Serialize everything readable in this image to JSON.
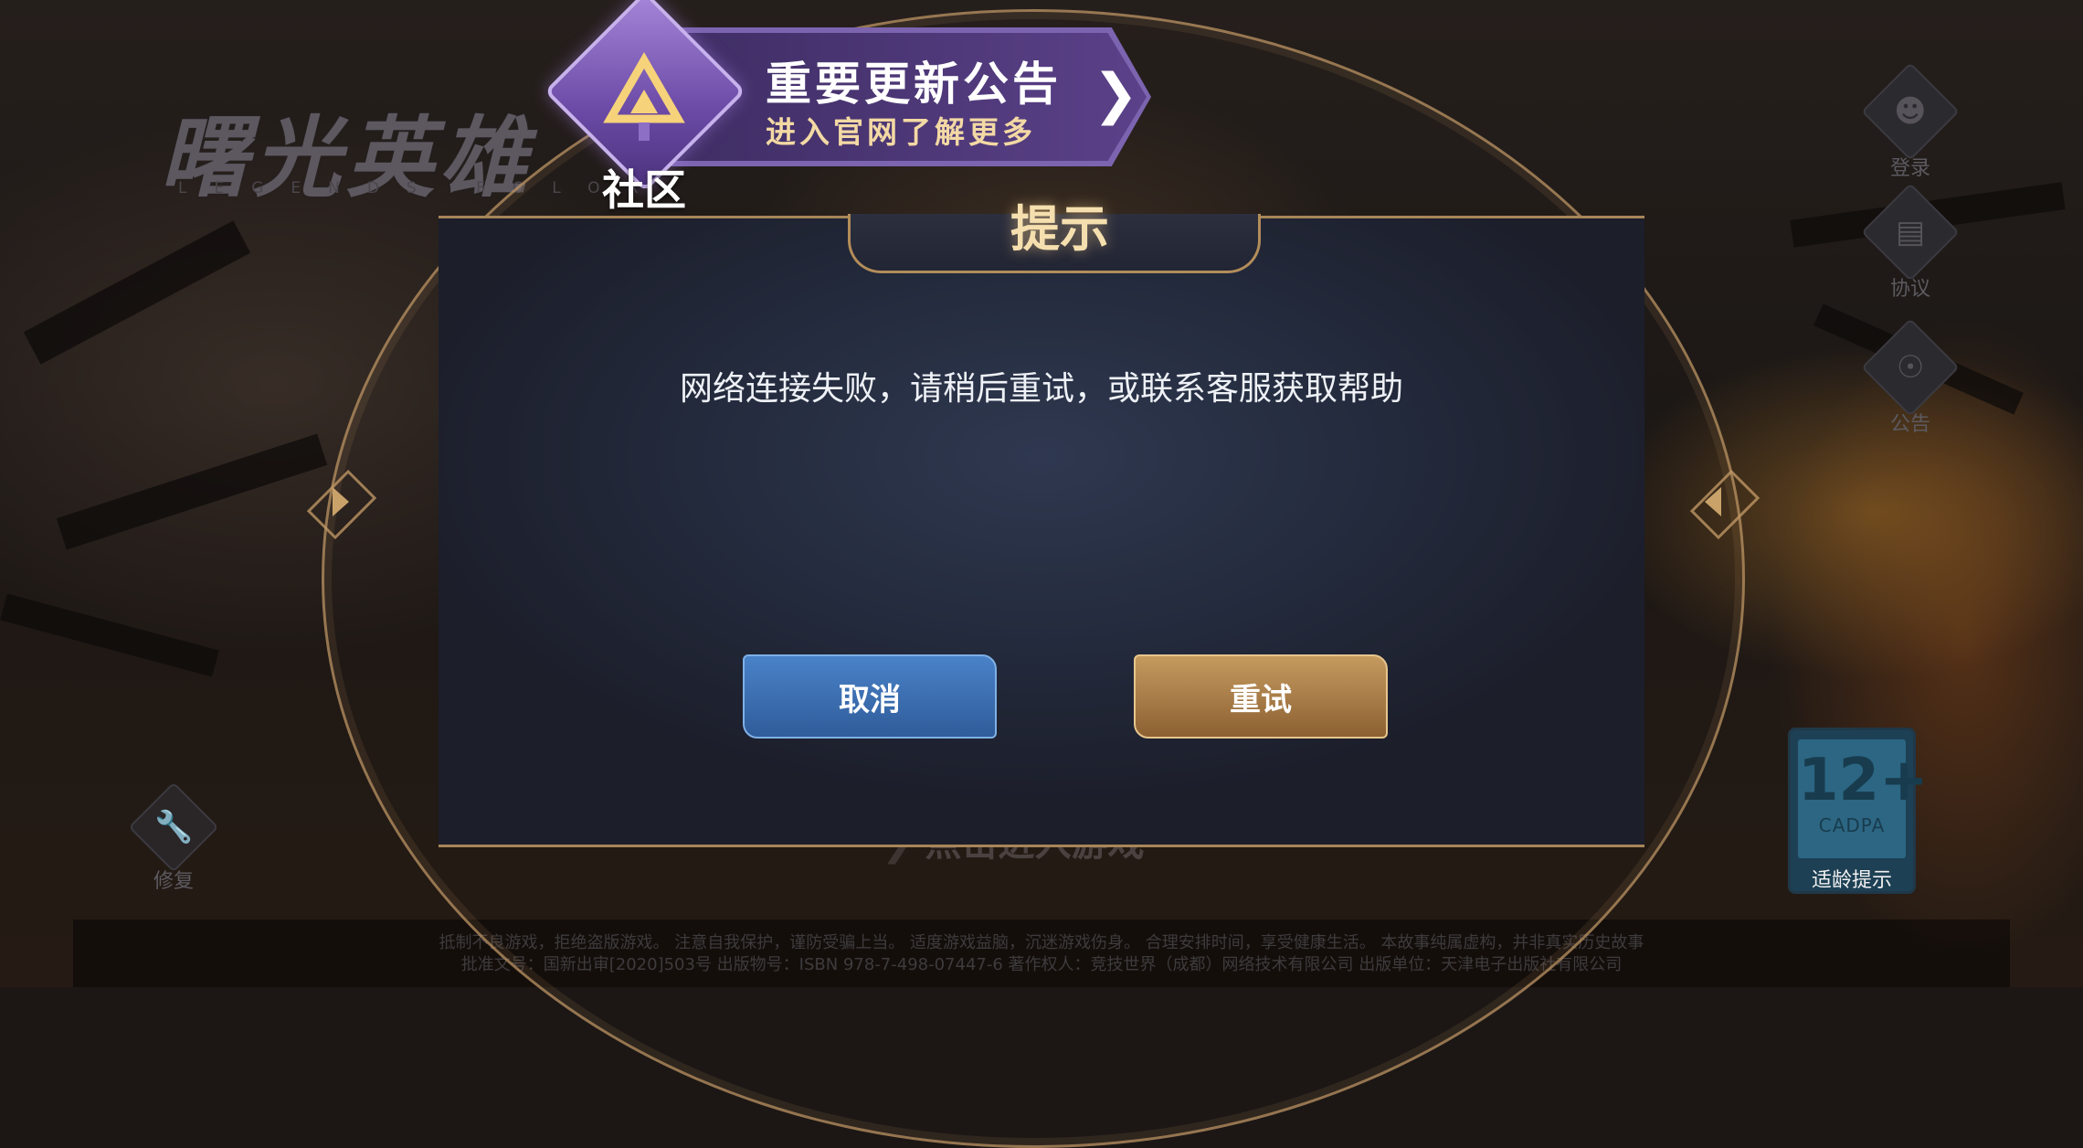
{
  "background": {
    "logo_text": "曙光英雄",
    "logo_sub": "LEGENDS FOLOR"
  },
  "side_buttons": [
    {
      "label": "登录",
      "icon": "user-icon"
    },
    {
      "label": "协议",
      "icon": "document-check-icon"
    },
    {
      "label": "公告",
      "icon": "megaphone-icon"
    }
  ],
  "repair": {
    "label": "修复",
    "icon": "wrench-icon"
  },
  "age_rating": {
    "number": "12+",
    "org": "CADPA",
    "label": "适龄提示"
  },
  "enter_hint": "点击进入游戏",
  "footer": {
    "line1": "抵制不良游戏，拒绝盗版游戏。 注意自我保护，谨防受骗上当。 适度游戏益脑，沉迷游戏伤身。 合理安排时间，享受健康生活。 本故事纯属虚构，并非真实历史故事",
    "line2": "批准文号：国新出审[2020]503号 出版物号：ISBN 978-7-498-07447-6 著作权人：竞技世界（成都）网络技术有限公司 出版单位：天津电子出版社有限公司"
  },
  "banner": {
    "title": "重要更新公告",
    "subtitle": "进入官网了解更多",
    "badge_label": "社区"
  },
  "dialog": {
    "title": "提示",
    "message": "网络连接失败，请稍后重试，或联系客服获取帮助",
    "cancel_label": "取消",
    "retry_label": "重试"
  },
  "colors": {
    "cancel_button": "#3d70b3",
    "retry_button": "#b08450",
    "title_text": "#f5dfae",
    "frame_gold": "#a78558"
  }
}
